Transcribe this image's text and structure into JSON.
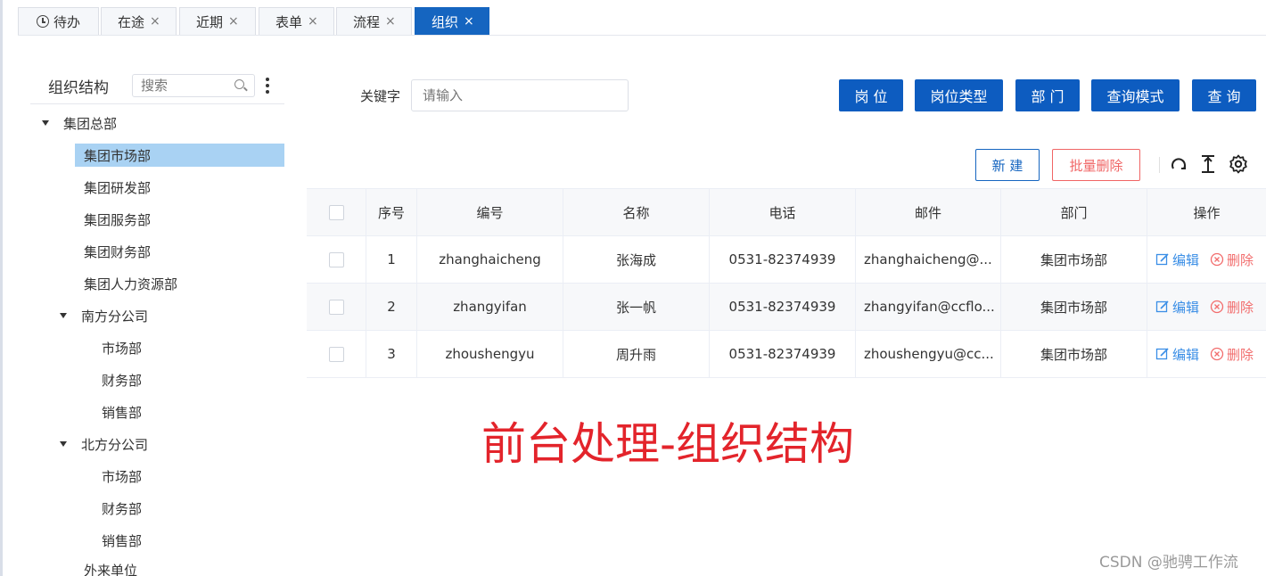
{
  "tabs": [
    {
      "label": "待办",
      "closable": false,
      "active": false,
      "icon": "clock-icon"
    },
    {
      "label": "在途",
      "closable": true,
      "active": false
    },
    {
      "label": "近期",
      "closable": true,
      "active": false
    },
    {
      "label": "表单",
      "closable": true,
      "active": false
    },
    {
      "label": "流程",
      "closable": true,
      "active": false
    },
    {
      "label": "组织",
      "closable": true,
      "active": true
    }
  ],
  "tab_close_glyph": "×",
  "sidebar": {
    "title": "组织结构",
    "search_placeholder": "搜索",
    "tree": [
      {
        "label": "集团总部",
        "expanded": true
      },
      {
        "label": "集团市场部",
        "selected": true
      },
      {
        "label": "集团研发部"
      },
      {
        "label": "集团服务部"
      },
      {
        "label": "集团财务部"
      },
      {
        "label": "集团人力资源部"
      },
      {
        "label": "南方分公司",
        "expanded": true
      },
      {
        "label": "市场部"
      },
      {
        "label": "财务部"
      },
      {
        "label": "销售部"
      },
      {
        "label": "北方分公司",
        "expanded": true
      },
      {
        "label": "市场部"
      },
      {
        "label": "财务部"
      },
      {
        "label": "销售部"
      },
      {
        "label": "外来单位"
      }
    ]
  },
  "filter": {
    "keyword_label": "关键字",
    "keyword_placeholder": "请输入",
    "buttons": {
      "post": "岗 位",
      "post_type": "岗位类型",
      "department": "部 门",
      "query_mode": "查询模式",
      "query": "查 询"
    }
  },
  "actions": {
    "new": "新 建",
    "batch_delete": "批量删除"
  },
  "table": {
    "columns": [
      "序号",
      "编号",
      "名称",
      "电话",
      "邮件",
      "部门",
      "操作"
    ],
    "rows": [
      {
        "index": "1",
        "code": "zhanghaicheng",
        "name": "张海成",
        "phone": "0531-82374939",
        "email": "zhanghaicheng@...",
        "dept": "集团市场部"
      },
      {
        "index": "2",
        "code": "zhangyifan",
        "name": "张一帆",
        "phone": "0531-82374939",
        "email": "zhangyifan@ccflo...",
        "dept": "集团市场部"
      },
      {
        "index": "3",
        "code": "zhoushengyu",
        "name": "周升雨",
        "phone": "0531-82374939",
        "email": "zhoushengyu@cc...",
        "dept": "集团市场部"
      }
    ],
    "op_edit": "编辑",
    "op_delete": "删除"
  },
  "overlay_text": "前台处理-组织结构",
  "watermark": "CSDN @驰骋工作流",
  "colors": {
    "primary": "#0d5cc0",
    "danger": "#f06565",
    "link": "#3a8ee6",
    "selected_bg": "#a9d2f3",
    "overlay": "#e3242b"
  }
}
